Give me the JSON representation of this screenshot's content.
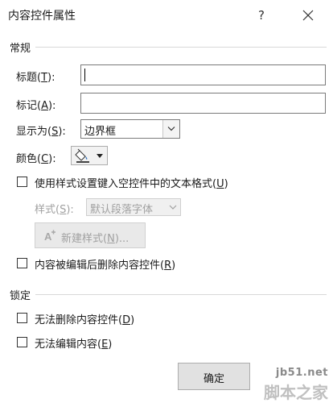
{
  "dialog": {
    "title": "内容控件属性",
    "help": "?"
  },
  "general": {
    "section_label": "常规",
    "title_label": "标题(",
    "title_hotkey": "T",
    "title_suffix": "):",
    "title_value": "",
    "tag_label": "标记(",
    "tag_hotkey": "A",
    "tag_suffix": "):",
    "tag_value": "",
    "show_as_label": "显示为(",
    "show_as_hotkey": "S",
    "show_as_suffix": "):",
    "show_as_value": "边界框",
    "color_label": "颜色(",
    "color_hotkey": "C",
    "color_suffix": "):",
    "use_style_label": "使用样式设置键入空控件中的文本格式(",
    "use_style_hotkey": "U",
    "use_style_suffix": ")",
    "use_style_checked": false,
    "style_label": "样式(",
    "style_hotkey": "S",
    "style_suffix": "):",
    "style_value": "默认段落字体",
    "new_style_label": "新建样式(",
    "new_style_hotkey": "N",
    "new_style_suffix": ")...",
    "remove_label": "内容被编辑后删除内容控件(",
    "remove_hotkey": "R",
    "remove_suffix": ")",
    "remove_checked": false
  },
  "locking": {
    "section_label": "锁定",
    "no_delete_label": "无法删除内容控件(",
    "no_delete_hotkey": "D",
    "no_delete_suffix": ")",
    "no_delete_checked": false,
    "no_edit_label": "无法编辑内容(",
    "no_edit_hotkey": "E",
    "no_edit_suffix": ")",
    "no_edit_checked": false
  },
  "buttons": {
    "ok": "确定"
  },
  "watermark": {
    "site": "jb51.net",
    "name": "脚本之家"
  }
}
